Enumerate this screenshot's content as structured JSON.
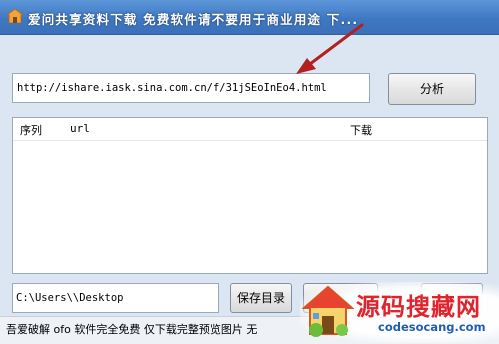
{
  "window": {
    "title": "爱问共享资料下载 免费软件请不要用于商业用途 下..."
  },
  "url_field": {
    "value": "http://ishare.iask.sina.com.cn/f/31jSEoInEo4.html"
  },
  "analyze_button": {
    "label": "分析"
  },
  "download_list": {
    "columns": [
      "序列",
      "url",
      "下载"
    ],
    "rows": []
  },
  "save_path_field": {
    "value": "C:\\Users\\\\Desktop"
  },
  "save_dir_button": {
    "label": "保存目录"
  },
  "status_bar": {
    "text": "吾爱破解 ofo 软件完全免费 仅下载完整预览图片 无"
  },
  "watermark": {
    "name": "源码搜藏网",
    "domain": "codesocang.com"
  },
  "colors": {
    "titlebar": "#4a86cf",
    "watermark_red": "#e0242e",
    "watermark_blue": "#1f5fb0",
    "annotation_arrow": "#b3201e"
  }
}
